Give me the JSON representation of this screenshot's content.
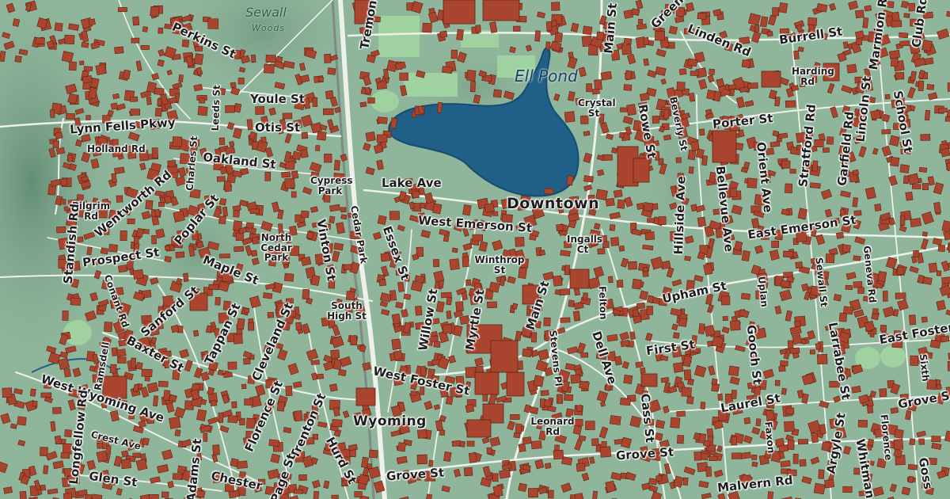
{
  "map": {
    "colors": {
      "land": "#8fb59b",
      "hills": "#6f9a80",
      "building": "#a9452e",
      "building_edge": "#5e2314",
      "water": "#1f5f88",
      "park": "#9fd2a0",
      "road": "#f1f3ee",
      "rail": "#7f8a86"
    },
    "labels": {
      "sewall": "Sewall",
      "woods": "Woods",
      "tremont": "Tremont",
      "main_st_n": "Main St",
      "green": "Green",
      "linden": "Linden Rd",
      "burrell": "Burrell St",
      "marmion": "Marmion Rd",
      "ell_pond": "Ell Pond",
      "perkins": "Perkins St",
      "youle": "Youle St",
      "otis": "Otis St",
      "lynn_fells": "Lynn Fells Pkwy",
      "holland": "Holland Rd",
      "oakland": "Oakland St",
      "leeds": "Leeds St",
      "charles": "Charles St",
      "cypress_park": "Cypress Park",
      "lake_ave": "Lake Ave",
      "crystal": "Crystal St",
      "rowe": "Rowe St",
      "beverly": "Beverly St",
      "porter": "Porter St",
      "stratford": "Stratford Rd",
      "garfield": "Garfield Rd",
      "school": "School St",
      "lincoln": "Lincoln St",
      "harding": "Harding Rd",
      "bellevue": "Bellevue Ave",
      "orient": "Orient Ave",
      "downtown": "Downtown",
      "hillside": "Hillside Ave",
      "west_emerson": "West Emerson St",
      "east_emerson": "East Emerson St",
      "wentworth": "Wentworth Rd",
      "pilgrim": "Pilgrim Rd",
      "poplar": "Poplar St",
      "standish": "Standish Rd",
      "prospect": "Prospect St",
      "north_cedar_park": "North Cedar Park",
      "vinton": "Vinton St",
      "cedar_park": "Cedar Park",
      "essex": "Essex St",
      "ingalls": "Ingalls Ct",
      "winthrop": "Winthrop St",
      "maple": "Maple St",
      "main_st_s": "Main St",
      "upham": "Upham St",
      "felton": "Felton",
      "sewall_st": "Sewall St",
      "geneva": "Geneva Rd",
      "sanford": "Sanford St",
      "conant": "Conant Rd",
      "south_high": "South High St",
      "willow": "Willow St",
      "myrtle": "Myrtle St",
      "tappan": "Tappan St",
      "baxter": "Baxter St",
      "cleveland": "Cleveland St",
      "first": "First St",
      "dell": "Dell Ave",
      "gooch": "Gooch St",
      "larrabee": "Larrabee St",
      "east_foster": "East Foster St",
      "ramsdell": "Ramsdell",
      "west_foster": "West Foster St",
      "stevens": "Stevens Pl",
      "west_wyoming": "West Wyoming Ave",
      "laurel": "Laurel St",
      "longfellow": "Longfellow Rd",
      "florence": "Florence St",
      "trenton": "Trenton St",
      "wyoming": "Wyoming",
      "leonard": "Leonard Rd",
      "cass": "Cass St",
      "crest": "Crest Ave",
      "argyle": "Argyle St",
      "whitman": "Whitman",
      "grove_e": "Grove St",
      "faxon": "Faxon",
      "glen": "Glen St",
      "adams": "Adams St",
      "chester": "Chester",
      "page": "Page St",
      "hurd": "Hurd St",
      "grove_s": "Grove St",
      "malvern": "Malvern Rd",
      "gossip": "Goss",
      "sixth": "Sixth",
      "grove_ne": "Grove S",
      "florence_e": "Florence",
      "club": "Club Rd",
      "uplan": "Uplan"
    }
  }
}
